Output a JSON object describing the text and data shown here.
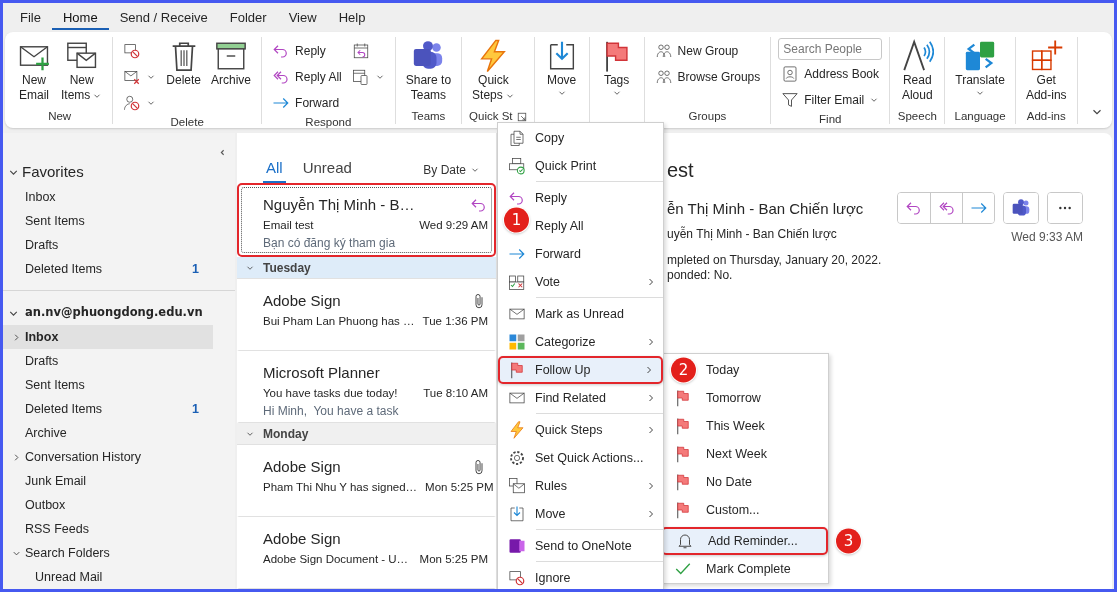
{
  "tabs": [
    {
      "label": "File",
      "selected": false
    },
    {
      "label": "Home",
      "selected": true
    },
    {
      "label": "Send / Receive",
      "selected": false
    },
    {
      "label": "Folder",
      "selected": false
    },
    {
      "label": "View",
      "selected": false
    },
    {
      "label": "Help",
      "selected": false
    }
  ],
  "ribbon": {
    "groups": [
      {
        "label": "New",
        "items": [
          {
            "kind": "large",
            "lines": [
              "New",
              "Email"
            ],
            "dropdown": false
          },
          {
            "kind": "large",
            "lines": [
              "New",
              "Items"
            ],
            "dropdown": true
          }
        ]
      },
      {
        "label": "Delete",
        "items": [
          {
            "kind": "stack",
            "items": [
              {
                "dropdown": false
              },
              {
                "dropdown": true
              },
              {
                "dropdown": true
              }
            ]
          },
          {
            "kind": "large",
            "lines": [
              "Delete"
            ],
            "dropdown": false
          },
          {
            "kind": "large",
            "lines": [
              "Archive"
            ],
            "dropdown": false
          }
        ]
      },
      {
        "label": "Respond",
        "items": [
          {
            "kind": "stack",
            "items": [
              {
                "label": "Reply",
                "dropdown": false
              },
              {
                "label": "Reply All",
                "dropdown": false
              },
              {
                "label": "Forward",
                "dropdown": false
              }
            ]
          },
          {
            "kind": "stack",
            "items": [
              {
                "dropdown": false
              },
              {
                "dropdown": true
              }
            ]
          }
        ]
      },
      {
        "label": "Teams",
        "items": [
          {
            "kind": "large",
            "lines": [
              "Share to",
              "Teams"
            ],
            "dropdown": false
          }
        ]
      },
      {
        "label": "Quick St",
        "launcher": true,
        "items": [
          {
            "kind": "large",
            "lines": [
              "Quick",
              "Steps"
            ],
            "dropdown": true
          }
        ]
      },
      {
        "items": [
          {
            "kind": "large",
            "lines": [
              "Move"
            ],
            "dropdown": true
          }
        ]
      },
      {
        "items": [
          {
            "kind": "large",
            "lines": [
              "Tags"
            ],
            "dropdown": true
          }
        ]
      },
      {
        "label": "Groups",
        "items": [
          {
            "kind": "stack",
            "items": [
              {
                "label": "New Group",
                "dropdown": false
              },
              {
                "label": "Browse Groups",
                "dropdown": false
              }
            ]
          }
        ]
      },
      {
        "label": "Find",
        "items": [
          {
            "kind": "stack",
            "items": [
              {
                "kind": "field",
                "placeholder": "Search People"
              },
              {
                "label": "Address Book",
                "dropdown": false
              },
              {
                "label": "Filter Email",
                "dropdown": true
              }
            ]
          }
        ]
      },
      {
        "label": "Speech",
        "items": [
          {
            "kind": "large",
            "lines": [
              "Read",
              "Aloud"
            ],
            "dropdown": false
          }
        ]
      },
      {
        "label": "Language",
        "items": [
          {
            "kind": "large",
            "lines": [
              "Translate"
            ],
            "dropdown": true
          }
        ]
      },
      {
        "label": "Add-ins",
        "items": [
          {
            "kind": "large",
            "lines": [
              "Get",
              "Add-ins"
            ],
            "dropdown": false
          }
        ]
      }
    ]
  },
  "nav": {
    "sections": [
      {
        "kind": "section",
        "label": "Favorites",
        "expanded": true,
        "children": [
          {
            "label": "Inbox",
            "selected": false
          },
          {
            "label": "Sent Items",
            "selected": false
          },
          {
            "label": "Drafts",
            "selected": false
          },
          {
            "label": "Deleted Items",
            "selected": false,
            "count": "1"
          }
        ]
      },
      {
        "kind": "account",
        "label": "an.nv@phuongdong.edu.vn",
        "expanded": true,
        "children": [
          {
            "label": "Inbox",
            "selected": true,
            "expanded": false
          },
          {
            "label": "Drafts",
            "selected": false
          },
          {
            "label": "Sent Items",
            "selected": false
          },
          {
            "label": "Deleted Items",
            "selected": false,
            "count": "1"
          },
          {
            "label": "Archive",
            "selected": false
          },
          {
            "label": "Conversation History",
            "selected": false,
            "expanded": false
          },
          {
            "label": "Junk Email",
            "selected": false
          },
          {
            "label": "Outbox",
            "selected": false
          },
          {
            "label": "RSS Feeds",
            "selected": false
          },
          {
            "label": "Search Folders",
            "selected": false,
            "expanded": true,
            "children": [
              {
                "label": "Unread Mail",
                "selected": false
              }
            ]
          }
        ]
      }
    ]
  },
  "message_list": {
    "filters": [
      {
        "label": "All",
        "selected": true
      },
      {
        "label": "Unread",
        "selected": false
      }
    ],
    "sort": "By Date",
    "items": [
      {
        "kind": "message",
        "sender": "Nguyễn Thị Minh - B…",
        "subject": "Email test",
        "time": "Wed 9:29 AM",
        "preview": "Bạn có đăng ký tham gia",
        "replied": true,
        "attachment": false,
        "selected": true,
        "highlighted": true,
        "callout": "1"
      },
      {
        "kind": "header",
        "label": "Tuesday",
        "selected": true
      },
      {
        "kind": "message",
        "sender": "Adobe Sign",
        "subject": "Bui Pham Lan Phuong has …",
        "time": "Tue 1:36 PM",
        "replied": false,
        "attachment": true,
        "selected": false,
        "highlighted": false
      },
      {
        "kind": "message",
        "sender": "Microsoft Planner",
        "subject": "You have tasks due today!",
        "time": "Tue 8:10 AM",
        "preview": "Hi Minh,  You have a task",
        "replied": false,
        "attachment": false,
        "selected": false,
        "highlighted": false
      },
      {
        "kind": "header",
        "label": "Monday",
        "selected": false
      },
      {
        "kind": "message",
        "sender": "Adobe Sign",
        "subject": "Pham Thi Nhu Y has signed…",
        "time": "Mon 5:25 PM",
        "replied": false,
        "attachment": true,
        "selected": false,
        "highlighted": false
      },
      {
        "kind": "message",
        "sender": "Adobe Sign",
        "subject": "Adobe Sign Document - U…",
        "time": "Mon 5:25 PM",
        "replied": false,
        "attachment": false,
        "selected": false,
        "highlighted": false
      }
    ]
  },
  "context_menu": {
    "sections": [
      [
        {
          "label": "Copy",
          "submenu": false,
          "selected": false,
          "highlighted": false
        },
        {
          "label": "Quick Print",
          "submenu": false,
          "selected": false,
          "highlighted": false
        }
      ],
      [
        {
          "label": "Reply",
          "submenu": false,
          "selected": false,
          "highlighted": false
        },
        {
          "label": "Reply All",
          "submenu": false,
          "selected": false,
          "highlighted": false,
          "icon_covered": true
        },
        {
          "label": "Forward",
          "submenu": false,
          "selected": false,
          "highlighted": false
        },
        {
          "label": "Vote",
          "submenu": true,
          "selected": false,
          "highlighted": false
        }
      ],
      [
        {
          "label": "Mark as Unread",
          "submenu": false,
          "selected": false,
          "highlighted": false
        },
        {
          "label": "Categorize",
          "submenu": true,
          "selected": false,
          "highlighted": false
        },
        {
          "label": "Follow Up",
          "submenu": true,
          "selected": true,
          "highlighted": true,
          "callout": "2"
        },
        {
          "label": "Find Related",
          "submenu": true,
          "selected": false,
          "highlighted": false
        }
      ],
      [
        {
          "label": "Quick Steps",
          "submenu": true,
          "selected": false,
          "highlighted": false
        },
        {
          "label": "Set Quick Actions...",
          "submenu": false,
          "selected": false,
          "highlighted": false
        },
        {
          "label": "Rules",
          "submenu": true,
          "selected": false,
          "highlighted": false
        },
        {
          "label": "Move",
          "submenu": true,
          "selected": false,
          "highlighted": false
        }
      ],
      [
        {
          "label": "Send to OneNote",
          "submenu": false,
          "selected": false,
          "highlighted": false
        }
      ],
      [
        {
          "label": "Ignore",
          "submenu": false,
          "selected": false,
          "highlighted": false
        }
      ]
    ]
  },
  "follow_up_menu": {
    "sections": [
      [
        {
          "label": "Today",
          "selected": false,
          "highlighted": false,
          "icon_covered": true
        },
        {
          "label": "Tomorrow",
          "selected": false,
          "highlighted": false
        },
        {
          "label": "This Week",
          "selected": false,
          "highlighted": false
        },
        {
          "label": "Next Week",
          "selected": false,
          "highlighted": false
        },
        {
          "label": "No Date",
          "selected": false,
          "highlighted": false
        },
        {
          "label": "Custom...",
          "selected": false,
          "highlighted": false
        }
      ],
      [
        {
          "label": "Add Reminder...",
          "selected": true,
          "highlighted": true,
          "callout": "3"
        },
        {
          "label": "Mark Complete",
          "selected": false,
          "highlighted": false
        }
      ]
    ]
  },
  "reading_pane": {
    "title": "est",
    "sender": "ễn Thị Minh - Ban Chiến lược",
    "recipient": "uyễn Thị Minh - Ban Chiến lược",
    "notes": [
      "mpleted on Thursday, January 20, 2022.",
      "ponded: No."
    ],
    "time": "Wed 9:33 AM"
  }
}
